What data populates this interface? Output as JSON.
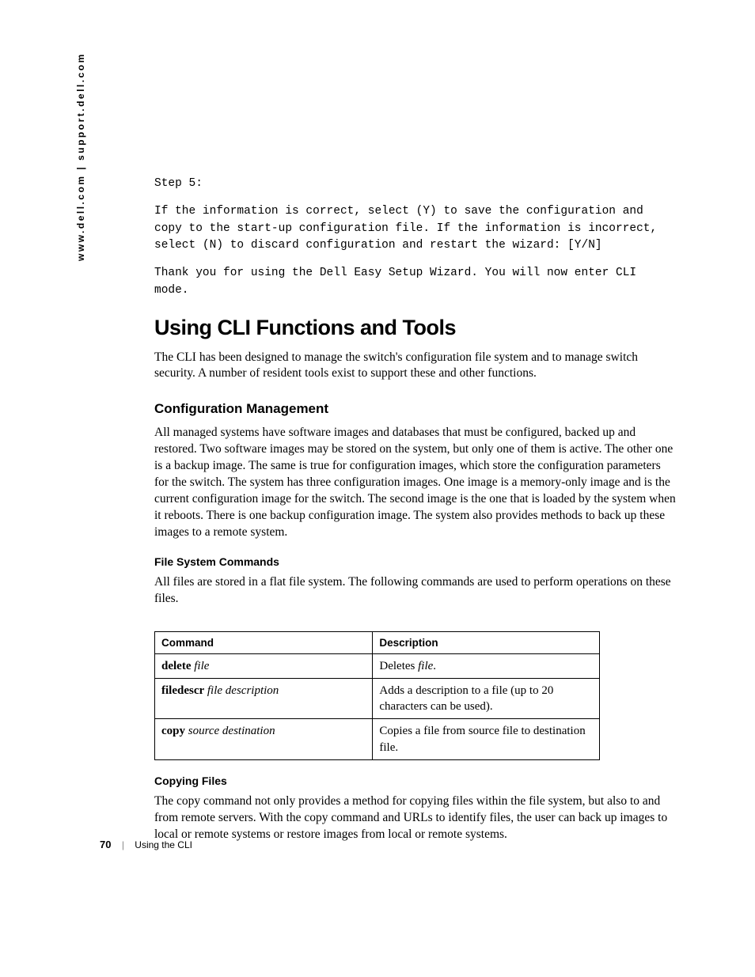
{
  "side_url": "www.dell.com | support.dell.com",
  "step_label": "Step 5:",
  "step_text": "If the information is correct, select (Y) to save the configuration and copy to the start-up configuration file. If the information is incorrect, select (N) to discard configuration and restart the wizard: [Y/N]",
  "thank_you": "Thank you for using the Dell Easy Setup Wizard. You will now enter CLI mode.",
  "main_heading": "Using CLI Functions and Tools",
  "main_intro": "The CLI has been designed to manage the switch's configuration file system and to manage switch security. A number of resident tools exist to support these and other functions.",
  "config_heading": "Configuration Management",
  "config_text": "All managed systems have software images and databases that must be configured, backed up and restored. Two software images may be stored on the system, but only one of them is active. The other one is a backup image. The same is true for configuration images, which store the configuration parameters for the switch. The system has three configuration images. One image is a memory-only image and is the current configuration image for the switch. The second image is the one that is loaded by the system when it reboots. There is one backup configuration image. The system also provides methods to back up these images to a remote system.",
  "fs_heading": "File System Commands",
  "fs_text": "All files are stored in a flat file system. The following commands are used to perform operations on these files.",
  "table": {
    "headers": [
      "Command",
      "Description"
    ],
    "rows": [
      {
        "cmd_bold": "delete",
        "cmd_italic": "file",
        "desc_pre": "Deletes ",
        "desc_italic": "file",
        "desc_post": "."
      },
      {
        "cmd_bold": "filedescr",
        "cmd_italic": "file description",
        "desc_pre": "Adds a description to a file (up to 20 characters can be used).",
        "desc_italic": "",
        "desc_post": ""
      },
      {
        "cmd_bold": "copy",
        "cmd_italic": "source destination",
        "desc_pre": "Copies a file from source file to destination file.",
        "desc_italic": "",
        "desc_post": ""
      }
    ]
  },
  "copy_heading": "Copying Files",
  "copy_text": "The copy command not only provides a method for copying files within the file system, but also to and from remote servers. With the copy command and URLs to identify files, the user can back up images to local or remote systems or restore images from local or remote systems.",
  "footer": {
    "page": "70",
    "section": "Using the CLI"
  }
}
